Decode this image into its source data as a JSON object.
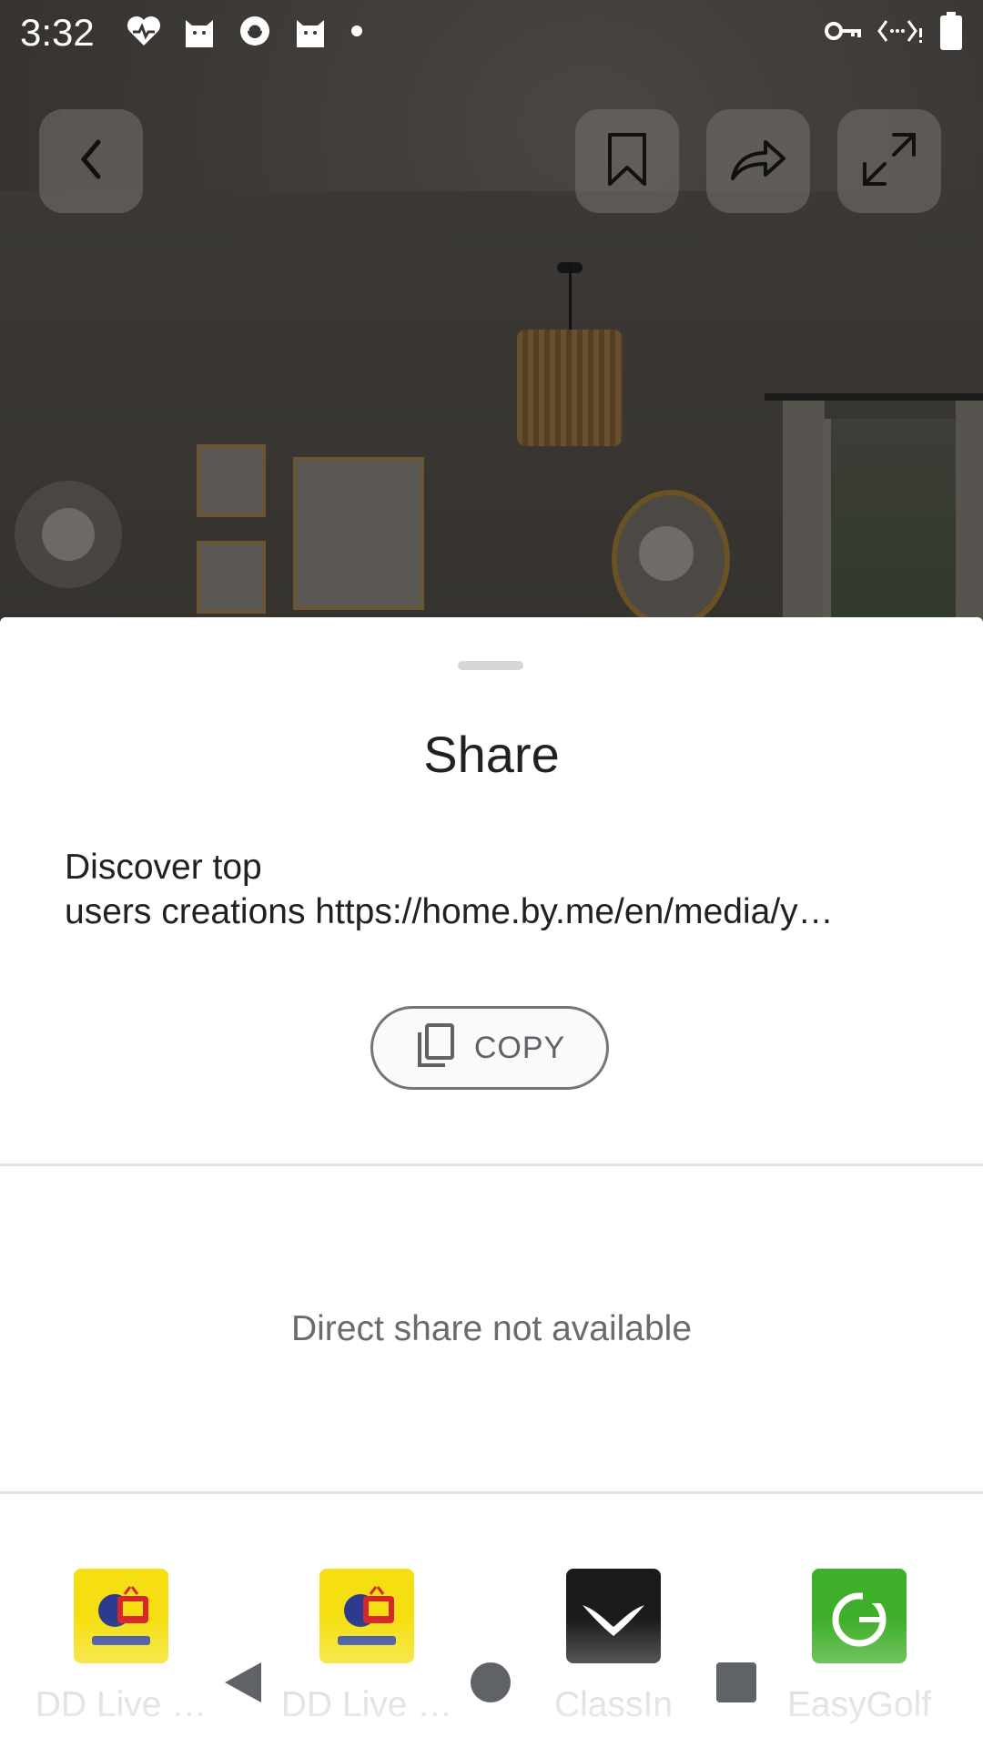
{
  "status_bar": {
    "time": "3:32",
    "left_icons": [
      "heart-pulse-icon",
      "cat-icon",
      "gear-badge-icon",
      "cat-icon",
      "dot-icon"
    ],
    "right_icons": [
      "vpn-key-icon",
      "data-transfer-icon",
      "battery-icon"
    ]
  },
  "viewer": {
    "controls": [
      "back-icon",
      "bookmark-icon",
      "share-icon",
      "expand-icon"
    ]
  },
  "sheet": {
    "title": "Share",
    "share_text_line1": "Discover top",
    "share_text_line2": "users creations https://home.by.me/en/media/y…",
    "copy_label": "COPY",
    "direct_share_message": "Direct share not available"
  },
  "apps": [
    {
      "label": "DD Live …",
      "icon": "dd-national-icon",
      "color": "#f5df12"
    },
    {
      "label": "DD Live …",
      "icon": "dd-national-icon",
      "color": "#f5df12"
    },
    {
      "label": "ClassIn",
      "icon": "classin-icon",
      "color": "#1b1b1b"
    },
    {
      "label": "EasyGolf",
      "icon": "easygolf-icon",
      "color": "#3fae2a"
    }
  ],
  "nav": [
    "back-nav-icon",
    "home-nav-icon",
    "recents-nav-icon"
  ]
}
